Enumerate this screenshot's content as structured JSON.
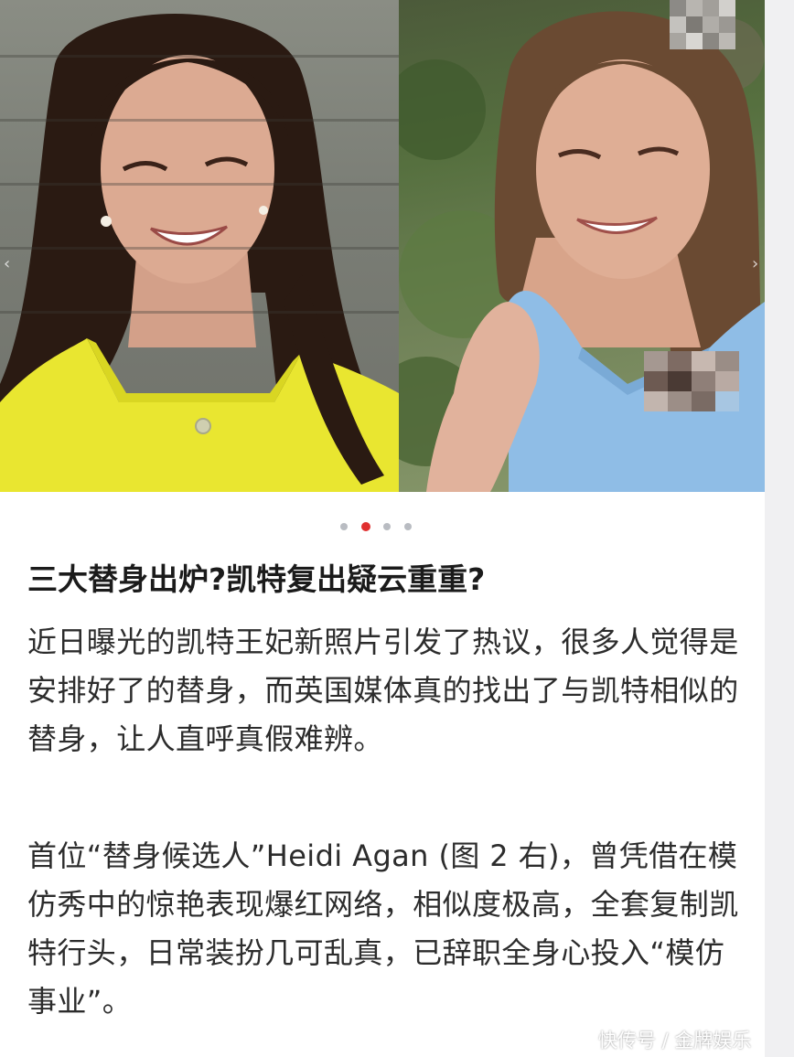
{
  "carousel": {
    "slide_count": 4,
    "active_index": 1,
    "left_arrow_glyph": "‹",
    "right_arrow_glyph": "›"
  },
  "article": {
    "title": "三大替身出炉?凯特复出疑云重重?",
    "paragraph_1": "近日曝光的凯特王妃新照片引发了热议，很多人觉得是安排好了的替身，而英国媒体真的找出了与凯特相似的替身，让人直呼真假难辨。",
    "paragraph_2": "首位“替身候选人”Heidi Agan (图 2 右)，曾凭借在模仿秀中的惊艳表现爆红网络，相似度极高，全套复制凯特行头，日常装扮几可乱真，已辞职全身心投入“模仿事业”。"
  },
  "watermark": {
    "text": "快传号 / 金牌娱乐"
  },
  "colors": {
    "accent_dot": "#e03030",
    "inactive_dot": "#b9bcc2",
    "title": "#1b1b1b",
    "body_text": "#2c2c2c",
    "yellow_dress": "#e9e630",
    "blue_dress": "#8fbde6"
  }
}
